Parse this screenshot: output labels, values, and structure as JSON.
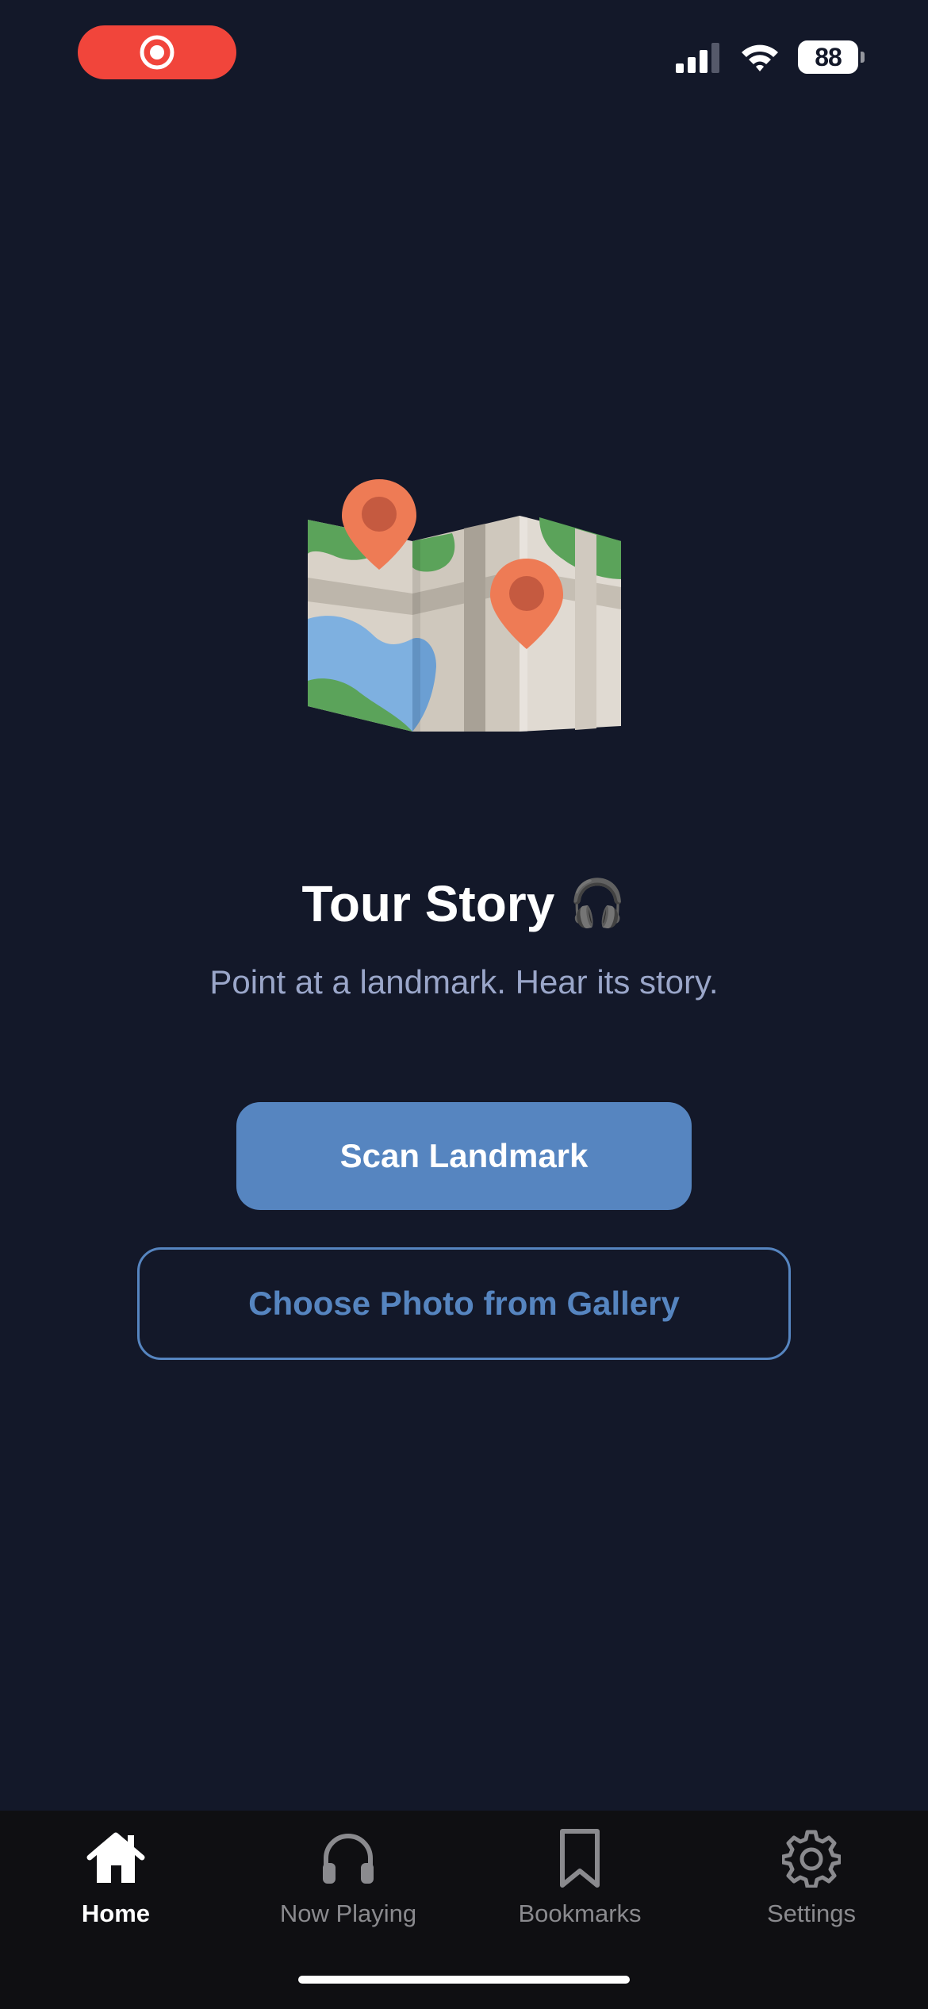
{
  "status_bar": {
    "battery_level": "88",
    "recording_indicator": "screen-recording-icon",
    "signal_icon": "cellular-signal-icon",
    "wifi_icon": "wifi-icon"
  },
  "hero": {
    "illustration": "folded-map-with-pins-icon",
    "title": "Tour Story",
    "title_emoji": "🎧",
    "tagline": "Point at a landmark. Hear its story."
  },
  "actions": {
    "primary_label": "Scan Landmark",
    "secondary_label": "Choose Photo from Gallery"
  },
  "tab_bar": {
    "tabs": [
      {
        "label": "Home",
        "icon": "home-icon",
        "active": true
      },
      {
        "label": "Now Playing",
        "icon": "headphones-icon",
        "active": false
      },
      {
        "label": "Bookmarks",
        "icon": "bookmark-icon",
        "active": false
      },
      {
        "label": "Settings",
        "icon": "gear-icon",
        "active": false
      }
    ]
  },
  "colors": {
    "background": "#131829",
    "accent": "#5685c0",
    "recording": "#f1453b",
    "tab_bar": "#0f0f12",
    "tagline": "#9aa6c9"
  }
}
